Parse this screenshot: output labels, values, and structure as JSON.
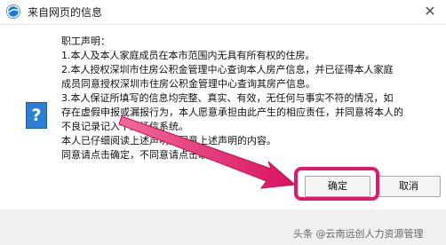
{
  "window": {
    "title": "来自网页的信息",
    "close_glyph": "✕",
    "icon": "ie-globe-icon"
  },
  "message": {
    "icon": "question-icon",
    "icon_glyph": "?",
    "lines": [
      "职工声明：",
      "    1.本人及本人家庭成员在本市范围内无具有所有权的住房。",
      "    2.本人授权深圳市住房公积金管理中心查询本人房产信息，并已征得本人家庭",
      "成员同意授权深圳市住房公积金管理中心查询其房产信息。",
      "    3.本人保证所填写的信息均完整、真实、有效，无任何与事实不符的情况，如",
      "存在虚假申报或漏报行为，本人愿意承担由此产生的相应责任，并同意将本人的",
      "不良记录记入个人征信系统。",
      "    本人已仔细阅读上述声明并同意上述声明的内容。",
      "    同意请点击确定，不同意请点击取消。"
    ]
  },
  "buttons": {
    "ok_label": "确定",
    "cancel_label": "取消"
  },
  "annotation": {
    "highlight_color": "#e0196a"
  },
  "watermark": {
    "text": "头条 @云南远创人力资源管理"
  }
}
